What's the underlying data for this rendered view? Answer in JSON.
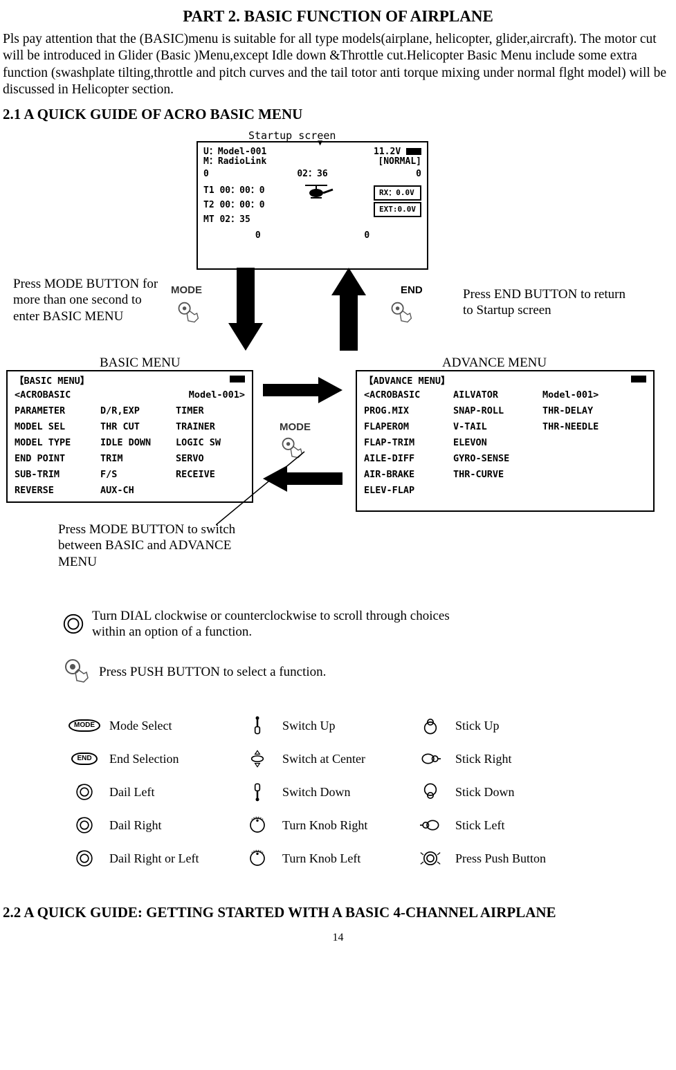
{
  "title": "PART 2. BASIC FUNCTION OF AIRPLANE",
  "intro": "Pls pay attention that the (BASIC)menu is suitable for all type models(airplane, helicopter, glider,aircraft). The motor cut will be introduced in Glider (Basic )Menu,except Idle down &Throttle cut.Helicopter Basic Menu include some extra function (swashplate tilting,throttle and pitch curves and the tail totor anti torque mixing under normal flght model) will be discussed in Helicopter section.",
  "section21": "2.1 A QUICK GUIDE OF ACRO BASIC MENU",
  "section22": "2.2 A QUICK GUIDE: GETTING STARTED WITH A BASIC 4-CHANNEL AIRPLANE",
  "pageNumber": "14",
  "startupLabel": "Startup screen",
  "captions": {
    "pressMode": "Press MODE BUTTON for more than one second to enter BASIC MENU",
    "pressEnd": "Press END BUTTON to return to Startup screen",
    "switchMenu": "Press MODE BUTTON to switch between BASIC and ADVANCE MENU",
    "dial": "Turn DIAL clockwise or counterclockwise to scroll through choices within an option of a function.",
    "push": "Press PUSH BUTTON to select a function."
  },
  "labels": {
    "mode": "MODE",
    "end": "END",
    "basicMenu": "BASIC MENU",
    "advanceMenu": "ADVANCE MENU"
  },
  "startupScreen": {
    "u": "U：Model-001",
    "volt": "11.2V",
    "m": "M：RadioLink",
    "normal": "[NORMAL]",
    "leftZero": "0",
    "time": "02：36",
    "rightZero": "0",
    "t1": "T1 00：00：0",
    "t2": "T2 00：00：0",
    "mt": "MT 02：35",
    "rx": "RX：0.0V",
    "ext": "EXT:0.0V",
    "bz1": "0",
    "bz2": "0"
  },
  "basicMenu": {
    "title": "【BASIC MENU】",
    "rowTop1": "<ACROBASIC",
    "rowTop2": "Model-001>",
    "items": [
      [
        "PARAMETER",
        "D/R,EXP",
        "TIMER"
      ],
      [
        "MODEL SEL",
        "THR CUT",
        "TRAINER"
      ],
      [
        "MODEL TYPE",
        "IDLE DOWN",
        "LOGIC SW"
      ],
      [
        "END POINT",
        "TRIM",
        "SERVO"
      ],
      [
        "SUB-TRIM",
        "F/S",
        "RECEIVE"
      ],
      [
        "REVERSE",
        "AUX-CH",
        ""
      ]
    ]
  },
  "advanceMenu": {
    "title": "【ADVANCE MENU】",
    "rowTop1": "<ACROBASIC",
    "rowTop2": "AILVATOR",
    "rowTop3": "Model-001>",
    "items": [
      [
        "PROG.MIX",
        "SNAP-ROLL",
        "THR-DELAY"
      ],
      [
        "FLAPEROM",
        "V-TAIL",
        "THR-NEEDLE"
      ],
      [
        "FLAP-TRIM",
        "ELEVON",
        ""
      ],
      [
        "AILE-DIFF",
        "GYRO-SENSE",
        ""
      ],
      [
        "AIR-BRAKE",
        "THR-CURVE",
        ""
      ],
      [
        "ELEV-FLAP",
        "",
        ""
      ]
    ]
  },
  "legend": [
    [
      {
        "icon": "mode-oval",
        "label": "Mode Select"
      },
      {
        "icon": "switch-up",
        "label": "Switch Up"
      },
      {
        "icon": "stick-up",
        "label": "Stick Up"
      }
    ],
    [
      {
        "icon": "end-oval",
        "label": "End Selection"
      },
      {
        "icon": "switch-center",
        "label": "Switch at Center"
      },
      {
        "icon": "stick-right",
        "label": "Stick Right"
      }
    ],
    [
      {
        "icon": "dial",
        "label": "Dail Left"
      },
      {
        "icon": "switch-down",
        "label": "Switch Down"
      },
      {
        "icon": "stick-down",
        "label": "Stick Down"
      }
    ],
    [
      {
        "icon": "dial",
        "label": "Dail Right"
      },
      {
        "icon": "knob",
        "label": "Turn Knob Right"
      },
      {
        "icon": "stick-left",
        "label": "Stick Left"
      }
    ],
    [
      {
        "icon": "dial",
        "label": "Dail Right or Left"
      },
      {
        "icon": "knob",
        "label": "Turn Knob Left"
      },
      {
        "icon": "push-btn",
        "label": "Press Push Button"
      }
    ]
  ]
}
